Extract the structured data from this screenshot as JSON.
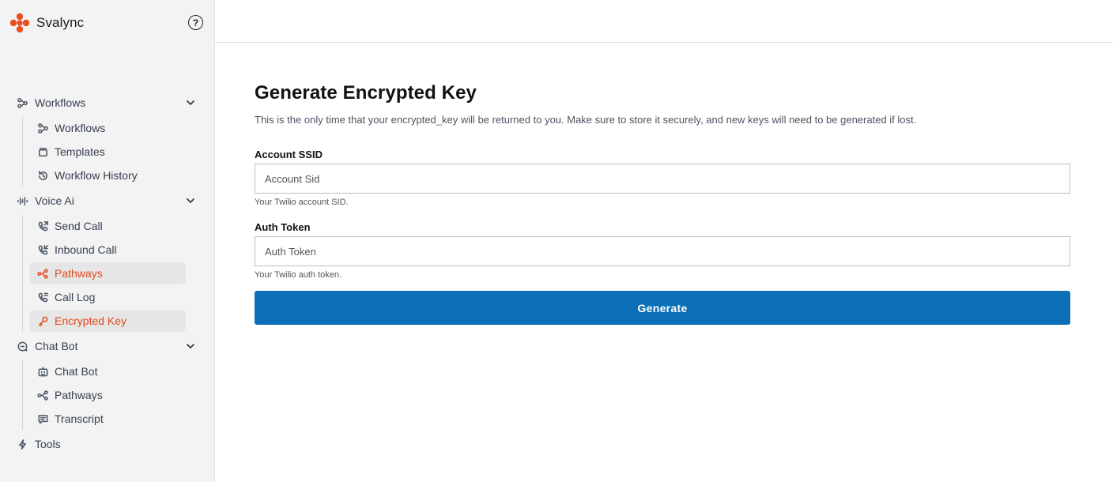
{
  "brand": {
    "name": "Svalync",
    "logo_icon": "four-petal-logo",
    "accent_color": "#e14a1b"
  },
  "help": {
    "icon": "question-circle-icon",
    "glyph": "?"
  },
  "sidebar": {
    "groups": [
      {
        "label": "Workflows",
        "icon": "workflow-icon",
        "expanded": true,
        "items": [
          {
            "label": "Workflows",
            "icon": "workflow-icon",
            "active": false
          },
          {
            "label": "Templates",
            "icon": "template-icon",
            "active": false
          },
          {
            "label": "Workflow History",
            "icon": "history-icon",
            "active": false
          }
        ]
      },
      {
        "label": "Voice Ai",
        "icon": "audio-wave-icon",
        "expanded": true,
        "items": [
          {
            "label": "Send Call",
            "icon": "phone-outgoing-icon",
            "active": false
          },
          {
            "label": "Inbound Call",
            "icon": "phone-incoming-icon",
            "active": false
          },
          {
            "label": "Pathways",
            "icon": "pathways-icon",
            "active": true
          },
          {
            "label": "Call Log",
            "icon": "phone-log-icon",
            "active": false
          },
          {
            "label": "Encrypted Key",
            "icon": "key-icon",
            "active": true
          }
        ]
      },
      {
        "label": "Chat Bot",
        "icon": "chat-bubble-icon",
        "expanded": true,
        "items": [
          {
            "label": "Chat Bot",
            "icon": "bot-icon",
            "active": false
          },
          {
            "label": "Pathways",
            "icon": "pathways-icon",
            "active": false
          },
          {
            "label": "Transcript",
            "icon": "transcript-icon",
            "active": false
          }
        ]
      }
    ],
    "tools": {
      "label": "Tools",
      "icon": "tools-icon"
    }
  },
  "main": {
    "title": "Generate Encrypted Key",
    "description": "This is the only time that your encrypted_key will be returned to you. Make sure to store it securely, and new keys will need to be generated if lost.",
    "fields": [
      {
        "label": "Account SSID",
        "placeholder": "Account Sid",
        "value": "",
        "hint": "Your Twilio account SID."
      },
      {
        "label": "Auth Token",
        "placeholder": "Auth Token",
        "value": "",
        "hint": "Your Twilio auth token."
      }
    ],
    "button": {
      "label": "Generate",
      "color": "#0b6fb8"
    }
  }
}
